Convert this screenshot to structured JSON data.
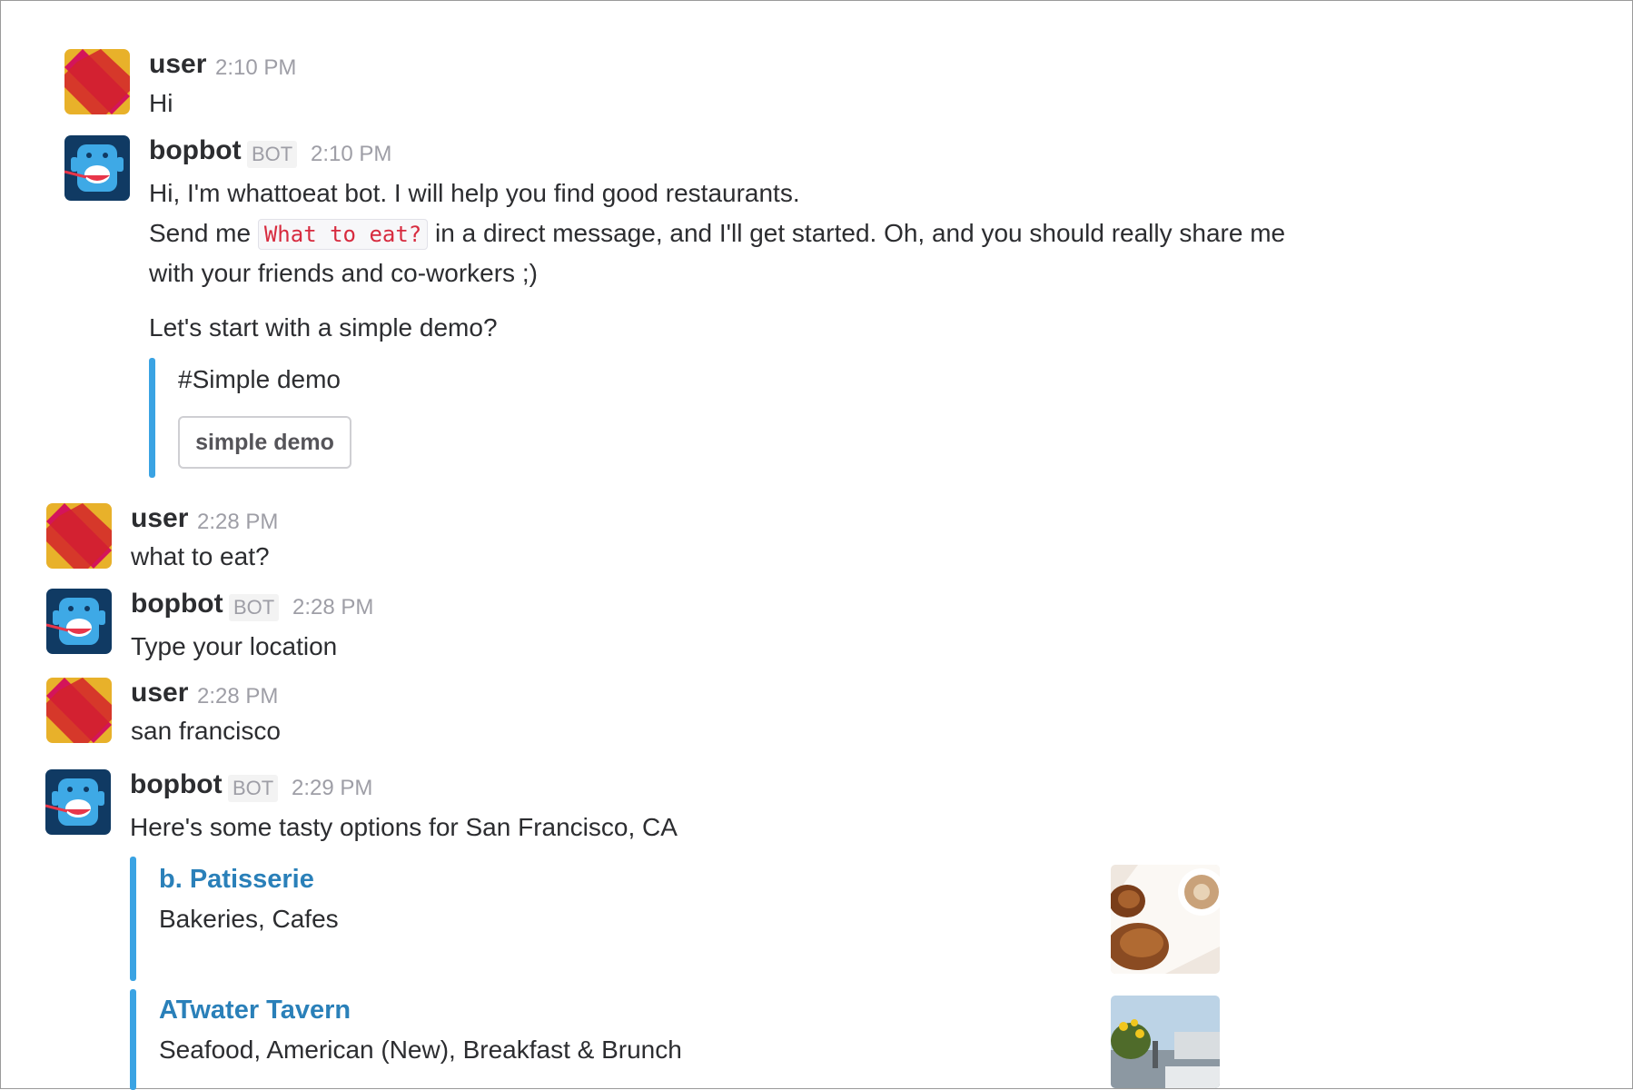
{
  "messages": [
    {
      "user": "user",
      "time": "2:10 PM",
      "text": "Hi"
    },
    {
      "user": "bopbot",
      "bot_tag": "BOT",
      "time": "2:10 PM",
      "line1": "Hi, I'm whattoeat bot. I will help you find good restaurants.",
      "line2_pre": "Send me ",
      "code": "What to eat?",
      "line2_post": " in a direct message, and I'll get started. Oh, and you should really share me",
      "line3": "with your friends and co-workers ;)",
      "line4": "Let's start with a simple demo?",
      "attachment_title": "#Simple demo",
      "button_label": "simple demo"
    },
    {
      "user": "user",
      "time": "2:28 PM",
      "text": "what to eat?"
    },
    {
      "user": "bopbot",
      "bot_tag": "BOT",
      "time": "2:28 PM",
      "text": "Type your location"
    },
    {
      "user": "user",
      "time": "2:28 PM",
      "text": "san francisco"
    },
    {
      "user": "bopbot",
      "bot_tag": "BOT",
      "time": "2:29 PM",
      "text": "Here's some tasty options for San Francisco, CA",
      "restaurants": [
        {
          "name": "b. Patisserie",
          "categories": "Bakeries, Cafes"
        },
        {
          "name": "ATwater Tavern",
          "categories": "Seafood, American (New), Breakfast & Brunch"
        }
      ]
    }
  ],
  "colors": {
    "accent_bar": "#3aa3e3",
    "link": "#2a80b9",
    "code_text": "#d72b3f"
  }
}
